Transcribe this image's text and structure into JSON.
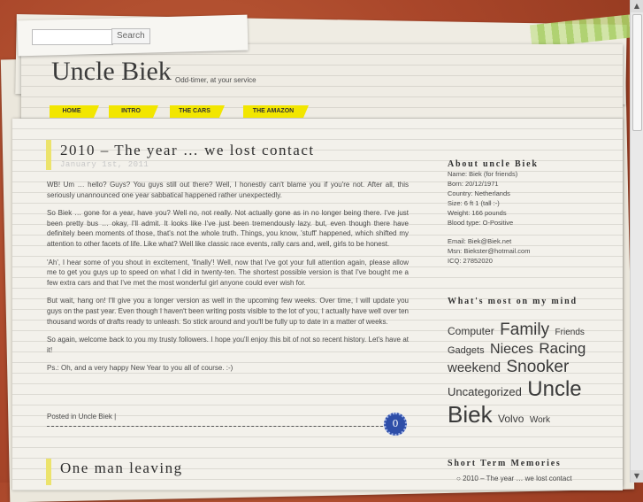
{
  "search": {
    "placeholder": "",
    "button_label": "Search"
  },
  "site": {
    "title": "Uncle Biek",
    "tagline": "Odd-timer, at your service"
  },
  "nav": [
    {
      "label": "HOME"
    },
    {
      "label": "INTRO"
    },
    {
      "label": "THE CARS"
    },
    {
      "label": "THE AMAZON"
    }
  ],
  "post": {
    "title": "2010 – The year … we lost contact",
    "date": "January 1st, 2011",
    "paragraphs": [
      "WB! Um … hello? Guys? You guys still out there? Well, I honestly can't blame you if you're not. After all, this seriously unannounced one year sabbatical happened rather unexpectedly.",
      "So Biek … gone for a year, have you? Well no, not really. Not actually gone as in no longer being there. I've just been pretty bus … okay, I'll admit. It looks like I've just been tremendously lazy. but, even though there have definitely been moments of those, that's not the whole truth. Things, you know, 'stuff' happened, which shifted my attention to other facets of life. Like what? Well like classic race events, rally cars and, well, girls to be honest.",
      "'Ah', I hear some of you shout in excitement, 'finally'! Well, now that I've got your full attention again, please allow me to get you guys up to speed on what I did in twenty-ten. The shortest possible version is that I've bought me a few extra cars and that I've met the most wonderful girl anyone could ever wish for.",
      "But wait, hang on! I'll give you a longer version as well in the upcoming few weeks. Over time, I will update you guys on the past year. Even though I haven't been writing posts visible to the lot of you, I actually have well over ten thousand words of drafts ready to unleash. So stick around and you'll be fully up to date in a matter of weeks.",
      "So again, welcome back to you my trusty followers. I hope you'll enjoy this bit of not so recent history.  Let's have at it!",
      "Ps.: Oh, and a very happy New Year to you all of course. :-)"
    ],
    "posted_in_label": "Posted in",
    "category": "Uncle Biek",
    "separator": "|",
    "comment_count": "0"
  },
  "next_post": {
    "title": "One man leaving"
  },
  "sidebar": {
    "about_title": "About uncle Biek",
    "about_lines": [
      "Name: Biek (for friends)",
      "Born: 20/12/1971",
      "Country: Netherlands",
      "Size: 6 ft 1 (tall :-)",
      "Weight: 166 pounds",
      "Blood type: O-Positive",
      "",
      "Email: Biek@Biek.net",
      "Msn: Biekster@hotmail.com",
      "ICQ: 27852020"
    ],
    "mind_title": "What's most on my mind",
    "tags": [
      {
        "label": "Computer",
        "size": 12
      },
      {
        "label": "Family",
        "size": 19
      },
      {
        "label": "Friends",
        "size": 10
      },
      {
        "label": "Gadgets",
        "size": 11
      },
      {
        "label": "Nieces",
        "size": 16
      },
      {
        "label": "Racing",
        "size": 17
      },
      {
        "label": "weekend",
        "size": 15
      },
      {
        "label": "Snooker",
        "size": 19
      },
      {
        "label": "Uncategorized",
        "size": 13
      },
      {
        "label": "Uncle",
        "size": 24
      },
      {
        "label": "Biek",
        "size": 26
      },
      {
        "label": "Volvo",
        "size": 12
      },
      {
        "label": "Work",
        "size": 10
      }
    ],
    "memories_title": "Short Term Memories",
    "memories": [
      "2010 – The year … we lost contact"
    ]
  },
  "colors": {
    "nav": "#f2e600",
    "accent_bar": "#ece36c",
    "comment_badge": "#2e4ea8"
  }
}
